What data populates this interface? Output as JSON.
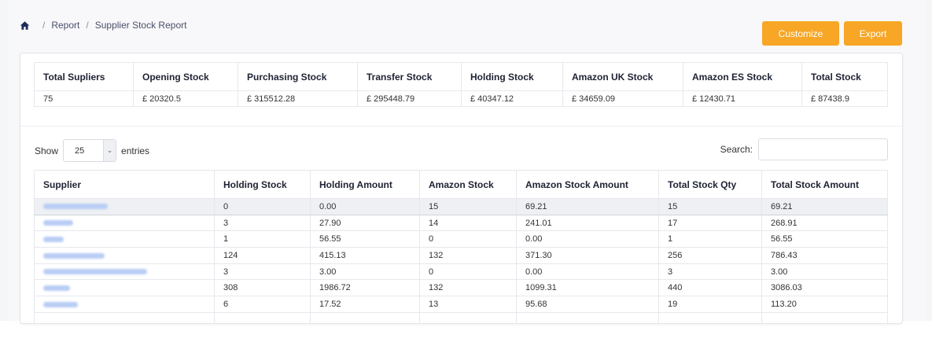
{
  "breadcrumb": {
    "icon": "home-icon",
    "items": [
      "Report",
      "Supplier Stock Report"
    ]
  },
  "actions": {
    "customize_label": "Customize",
    "export_label": "Export",
    "color": "#f7a626"
  },
  "summary": {
    "headers": [
      "Total Supliers",
      "Opening Stock",
      "Purchasing Stock",
      "Transfer Stock",
      "Holding Stock",
      "Amazon UK Stock",
      "Amazon ES Stock",
      "Total Stock"
    ],
    "values": [
      "75",
      "£ 20320.5",
      "£ 315512.28",
      "£ 295448.79",
      "£ 40347.12",
      "£ 34659.09",
      "£ 12430.71",
      "£ 87438.9"
    ]
  },
  "length_menu": {
    "show_label": "Show",
    "selected": "25",
    "entries_label": "entries"
  },
  "search": {
    "label": "Search:",
    "value": ""
  },
  "table": {
    "headers": [
      "Supplier",
      "Holding Stock",
      "Holding Amount",
      "Amazon Stock",
      "Amazon Stock Amount",
      "Total Stock Qty",
      "Total Stock Amount"
    ],
    "rows": [
      [
        "0",
        "0.00",
        "15",
        "69.21",
        "15",
        "69.21"
      ],
      [
        "3",
        "27.90",
        "14",
        "241.01",
        "17",
        "268.91"
      ],
      [
        "1",
        "56.55",
        "0",
        "0.00",
        "1",
        "56.55"
      ],
      [
        "124",
        "415.13",
        "132",
        "371.30",
        "256",
        "786.43"
      ],
      [
        "3",
        "3.00",
        "0",
        "0.00",
        "3",
        "3.00"
      ],
      [
        "308",
        "1986.72",
        "132",
        "1099.31",
        "440",
        "3086.03"
      ],
      [
        "6",
        "17.52",
        "13",
        "95.68",
        "19",
        "113.20"
      ]
    ]
  }
}
